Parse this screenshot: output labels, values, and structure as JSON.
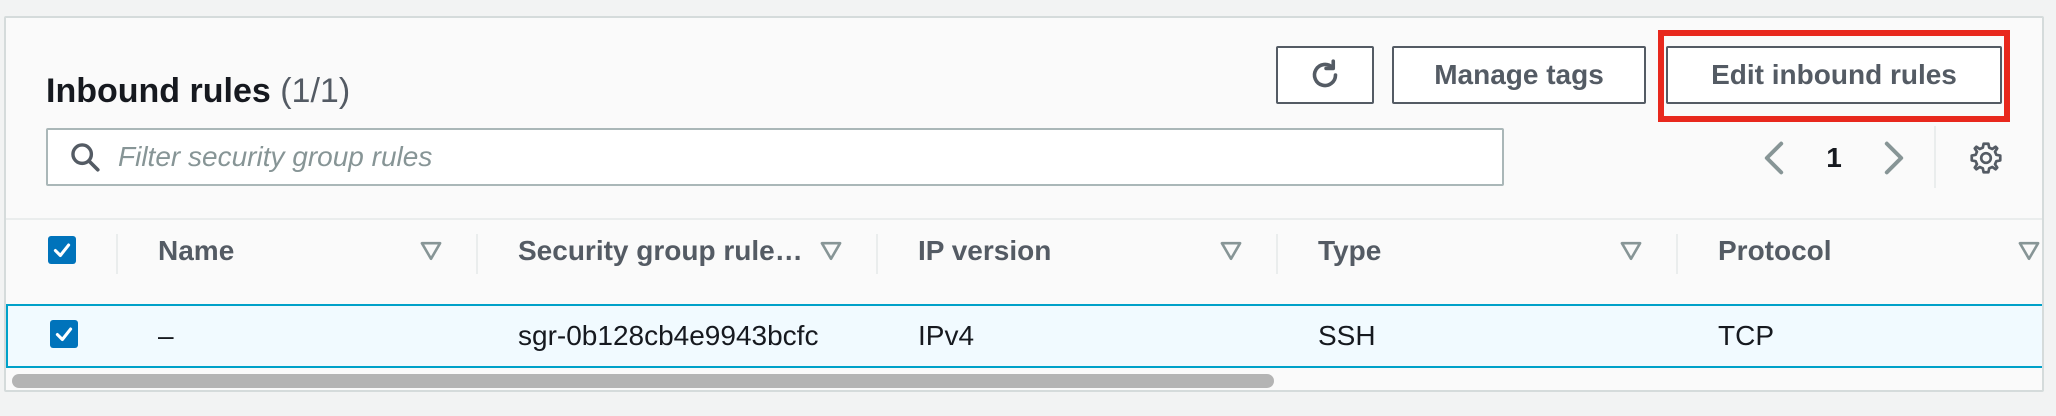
{
  "panel": {
    "title": "Inbound rules",
    "count": "(1/1)"
  },
  "buttons": {
    "refresh_icon": "refresh-icon",
    "manage_tags": "Manage tags",
    "edit_inbound_rules": "Edit inbound rules"
  },
  "search": {
    "placeholder": "Filter security group rules",
    "value": ""
  },
  "pagination": {
    "current_page": "1"
  },
  "table": {
    "columns": [
      "Name",
      "Security group rule…",
      "IP version",
      "Type",
      "Protocol"
    ],
    "rows": [
      {
        "selected": true,
        "name": "–",
        "security_group_rule_id": "sgr-0b128cb4e9943bcfc",
        "ip_version": "IPv4",
        "type": "SSH",
        "protocol": "TCP"
      }
    ]
  },
  "colors": {
    "accent": "#0073bb",
    "highlight": "#e8281d",
    "selected_row_bg": "#f1faff",
    "selected_row_border": "#00a1c9"
  }
}
